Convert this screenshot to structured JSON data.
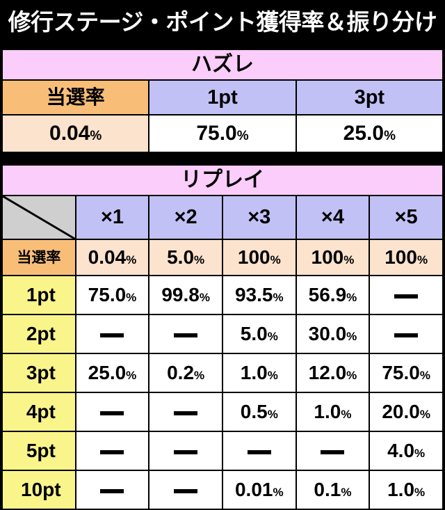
{
  "title": "修行ステージ・ポイント獲得率＆振り分け",
  "colors": {
    "background": "#000000",
    "title_text": "#ffffff",
    "section_header": "#fbcdfa",
    "column_header": "#c2c1f5",
    "rate_header": "#f8be78",
    "rate_cell": "#fbe3ce",
    "row_header": "#faf58a",
    "value_cell": "#ffffff",
    "corner_cell": "#cfcfcf",
    "border": "#000000"
  },
  "percent_symbol": "%",
  "dash_symbol": "—",
  "table_hazure": {
    "section_label": "ハズレ",
    "headers": [
      "当選率",
      "1pt",
      "3pt"
    ],
    "values": [
      "0.04",
      "75.0",
      "25.0"
    ]
  },
  "table_replay": {
    "section_label": "リプレイ",
    "corner_label": "",
    "column_headers": [
      "×1",
      "×2",
      "×3",
      "×4",
      "×5"
    ],
    "rate_row": {
      "label": "当選率",
      "values": [
        "0.04",
        "5.0",
        "100",
        "100",
        "100"
      ]
    },
    "rows": [
      {
        "label": "1pt",
        "values": [
          "75.0",
          "99.8",
          "93.5",
          "56.9",
          "—"
        ]
      },
      {
        "label": "2pt",
        "values": [
          "—",
          "—",
          "5.0",
          "30.0",
          "—"
        ]
      },
      {
        "label": "3pt",
        "values": [
          "25.0",
          "0.2",
          "1.0",
          "12.0",
          "75.0"
        ]
      },
      {
        "label": "4pt",
        "values": [
          "—",
          "—",
          "0.5",
          "1.0",
          "20.0"
        ]
      },
      {
        "label": "5pt",
        "values": [
          "—",
          "—",
          "—",
          "—",
          "4.0"
        ]
      },
      {
        "label": "10pt",
        "values": [
          "—",
          "—",
          "0.01",
          "0.1",
          "1.0"
        ]
      }
    ]
  }
}
